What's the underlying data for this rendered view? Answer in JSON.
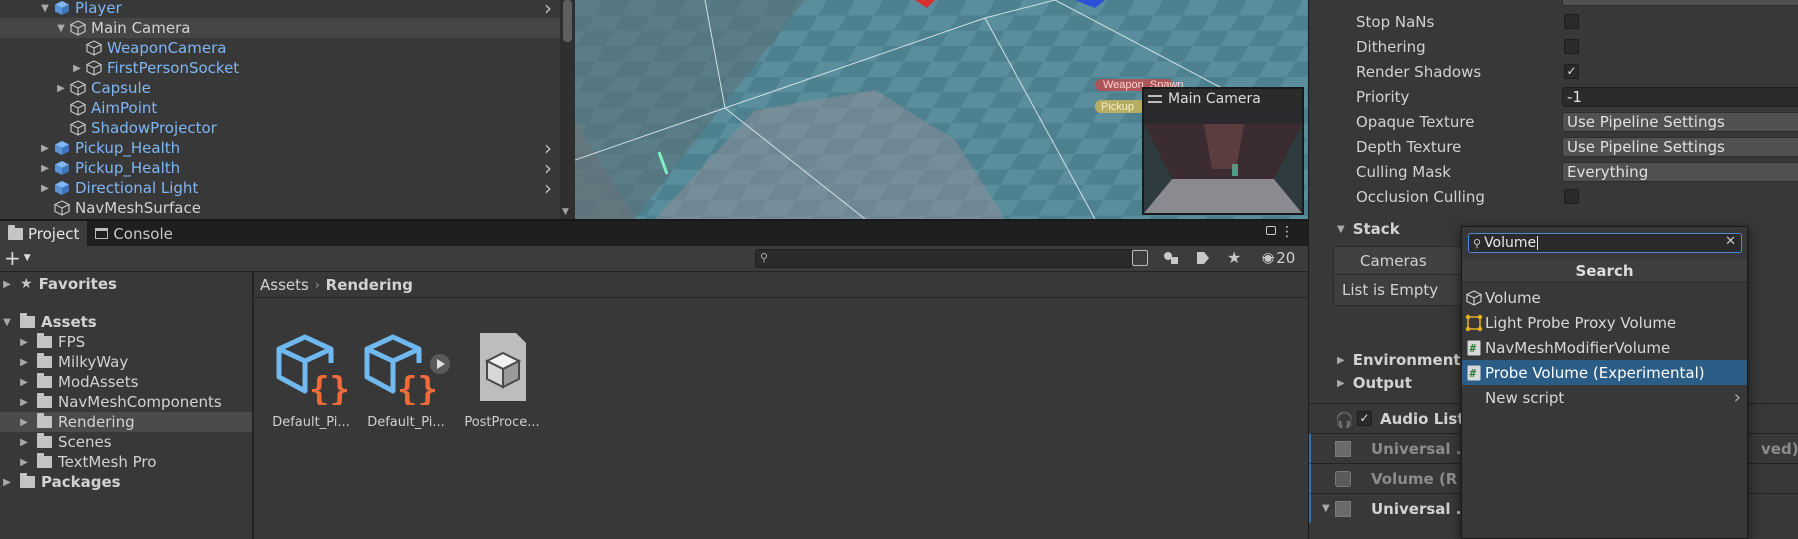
{
  "hierarchy": {
    "items": [
      {
        "label": "Player",
        "indent": 1,
        "expanded": true,
        "has_children": true,
        "prefab": true,
        "more": true
      },
      {
        "label": "Main Camera",
        "indent": 2,
        "expanded": true,
        "has_children": true,
        "prefab": false,
        "selected": true
      },
      {
        "label": "WeaponCamera",
        "indent": 3,
        "has_children": false,
        "prefab": false,
        "blue": true
      },
      {
        "label": "FirstPersonSocket",
        "indent": 3,
        "has_children": true,
        "prefab": false,
        "blue": true
      },
      {
        "label": "Capsule",
        "indent": 2,
        "has_children": true,
        "prefab": false,
        "blue": true
      },
      {
        "label": "AimPoint",
        "indent": 2,
        "has_children": false,
        "prefab": false,
        "blue": true
      },
      {
        "label": "ShadowProjector",
        "indent": 2,
        "has_children": false,
        "prefab": false,
        "blue": true
      },
      {
        "label": "Pickup_Health",
        "indent": 1,
        "has_children": true,
        "prefab": true,
        "more": true
      },
      {
        "label": "Pickup_Health",
        "indent": 1,
        "has_children": true,
        "prefab": true,
        "more": true
      },
      {
        "label": "Directional Light",
        "indent": 1,
        "has_children": true,
        "prefab": true,
        "more": true
      },
      {
        "label": "NavMeshSurface",
        "indent": 1,
        "has_children": false,
        "prefab": false
      }
    ]
  },
  "scene": {
    "camera_preview_title": "Main Camera",
    "overlay_label_1": "Weapon_Spawn",
    "overlay_label_2": "Pickup"
  },
  "project": {
    "tabs": [
      {
        "label": "Project",
        "active": true
      },
      {
        "label": "Console",
        "active": false
      }
    ],
    "add_label": "+",
    "hidden_count": "20",
    "tree": [
      {
        "label": "Favorites",
        "indent": 0,
        "bold": true,
        "icon": "star-icon"
      },
      {
        "label": "Assets",
        "indent": 0,
        "bold": true,
        "icon": "folder-icon",
        "expanded": true
      },
      {
        "label": "FPS",
        "indent": 1,
        "icon": "folder-icon"
      },
      {
        "label": "MilkyWay",
        "indent": 1,
        "icon": "folder-icon"
      },
      {
        "label": "ModAssets",
        "indent": 1,
        "icon": "folder-icon"
      },
      {
        "label": "NavMeshComponents",
        "indent": 1,
        "icon": "folder-icon"
      },
      {
        "label": "Rendering",
        "indent": 1,
        "icon": "folder-icon",
        "selected": true
      },
      {
        "label": "Scenes",
        "indent": 1,
        "icon": "folder-icon"
      },
      {
        "label": "TextMesh Pro",
        "indent": 1,
        "icon": "folder-icon"
      },
      {
        "label": "Packages",
        "indent": 0,
        "bold": true,
        "icon": "folder-icon"
      }
    ],
    "breadcrumb": [
      "Assets",
      "Rendering"
    ],
    "assets": [
      {
        "label": "Default_Pi...",
        "icon": "scriptable-object-icon",
        "play": false
      },
      {
        "label": "Default_Pi...",
        "icon": "scriptable-object-icon",
        "play": true
      },
      {
        "label": "PostProce...",
        "icon": "asset-file-icon",
        "play": false
      }
    ]
  },
  "inspector": {
    "rows": [
      {
        "label": "Stop NaNs",
        "type": "checkbox",
        "checked": false
      },
      {
        "label": "Dithering",
        "type": "checkbox",
        "checked": false
      },
      {
        "label": "Render Shadows",
        "type": "checkbox",
        "checked": true
      },
      {
        "label": "Priority",
        "type": "text",
        "value": "-1"
      },
      {
        "label": "Opaque Texture",
        "type": "dropdown",
        "value": "Use Pipeline Settings"
      },
      {
        "label": "Depth Texture",
        "type": "dropdown",
        "value": "Use Pipeline Settings"
      },
      {
        "label": "Culling Mask",
        "type": "dropdown",
        "value": "Everything"
      },
      {
        "label": "Occlusion Culling",
        "type": "checkbox",
        "checked": false
      }
    ],
    "stack_label": "Stack",
    "cameras_label": "Cameras",
    "list_empty": "List is Empty",
    "environment_label": "Environment",
    "output_label": "Output",
    "components": [
      {
        "name": "Audio List",
        "dim": false,
        "checkbox": true
      },
      {
        "name": "Universal ...",
        "suffix": "ved)",
        "dim": true
      },
      {
        "name": "Volume (R",
        "dim": true
      },
      {
        "name": "Universal ...",
        "dim": false
      }
    ]
  },
  "popup": {
    "search_value": "Volume",
    "header": "Search",
    "items": [
      {
        "label": "Volume",
        "icon": "volume-icon"
      },
      {
        "label": "Light Probe Proxy Volume",
        "icon": "light-probe-proxy-icon"
      },
      {
        "label": "NavMeshModifierVolume",
        "icon": "script-icon"
      },
      {
        "label": "Probe Volume (Experimental)",
        "icon": "script-icon",
        "selected": true
      },
      {
        "label": "New script",
        "icon": "",
        "submenu": true
      }
    ]
  }
}
